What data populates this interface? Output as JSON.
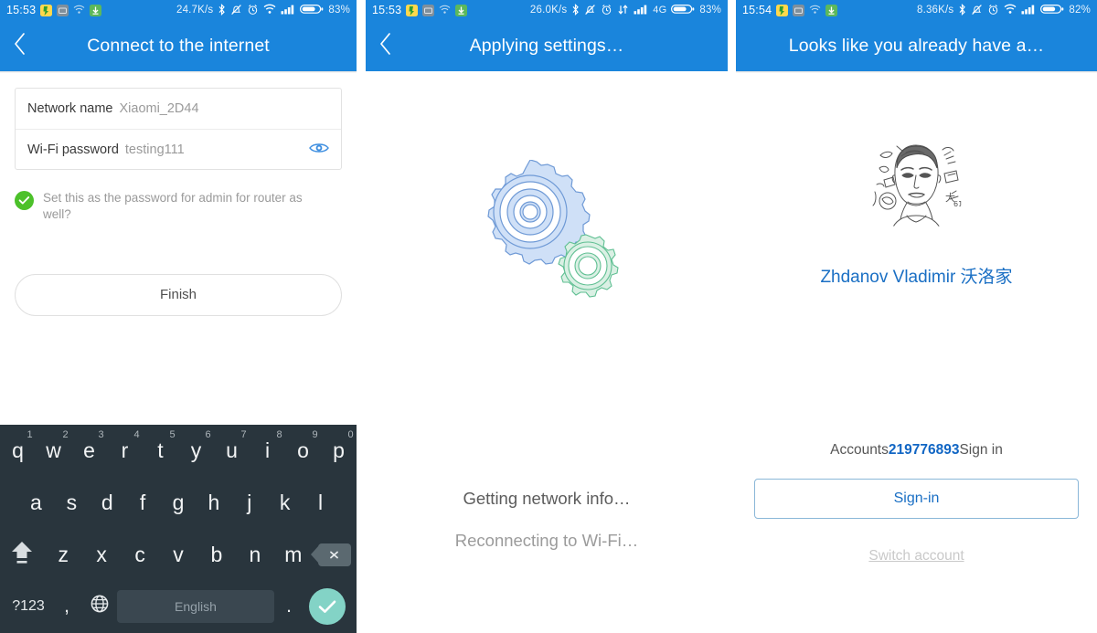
{
  "panels": [
    {
      "statusbar": {
        "time": "15:53",
        "icons_left": [
          "app-yellow-icon",
          "app-gray-icon",
          "wifi-small-icon",
          "download-icon"
        ],
        "net_speed": "24.7K/s",
        "icons_right": [
          "bluetooth-icon",
          "mute-bell-icon",
          "alarm-icon",
          "wifi-icon",
          "signal-bars-icon"
        ],
        "network_type": "",
        "battery": "83%"
      },
      "header": {
        "title": "Connect to the internet",
        "back_icon": "chevron-left-icon"
      },
      "form": {
        "network": {
          "label": "Network name",
          "value": "Xiaomi_2D44"
        },
        "password": {
          "label": "Wi-Fi password",
          "value": "testing111",
          "eye_icon": "eye-icon"
        },
        "checkbox": {
          "checked": true,
          "label": "Set this as the password for admin for router as well?"
        },
        "finish_label": "Finish"
      },
      "keyboard": {
        "row1": [
          {
            "key": "q",
            "num": "1"
          },
          {
            "key": "w",
            "num": "2"
          },
          {
            "key": "e",
            "num": "3"
          },
          {
            "key": "r",
            "num": "4"
          },
          {
            "key": "t",
            "num": "5"
          },
          {
            "key": "y",
            "num": "6"
          },
          {
            "key": "u",
            "num": "7"
          },
          {
            "key": "i",
            "num": "8"
          },
          {
            "key": "o",
            "num": "9"
          },
          {
            "key": "p",
            "num": "0"
          }
        ],
        "row2": [
          "a",
          "s",
          "d",
          "f",
          "g",
          "h",
          "j",
          "k",
          "l"
        ],
        "row3": [
          "z",
          "x",
          "c",
          "v",
          "b",
          "n",
          "m"
        ],
        "shift_icon": "shift-icon",
        "delete_icon": "backspace-icon",
        "symbols_label": "?123",
        "comma_label": ",",
        "globe_icon": "globe-icon",
        "space_label": "English",
        "period_label": ".",
        "enter_icon": "check-icon"
      }
    },
    {
      "statusbar": {
        "time": "15:53",
        "net_speed": "26.0K/s",
        "network_type": "4G",
        "battery": "83%"
      },
      "header": {
        "title": "Applying settings…",
        "back_icon": "chevron-left-icon"
      },
      "graphic": {
        "name": "gears-icon",
        "big_gear_color": "#cfe0f7",
        "small_gear_color": "#daf0e4"
      },
      "status": {
        "line1": "Getting network info…",
        "line2": "Reconnecting to Wi-Fi…"
      }
    },
    {
      "statusbar": {
        "time": "15:54",
        "net_speed": "8.36K/s",
        "network_type": "",
        "battery": "82%"
      },
      "header": {
        "title": "Looks like you already have a…"
      },
      "account": {
        "avatar_icon": "user-avatar-sketch",
        "display_name": "Zhdanov Vladimir 沃洛家",
        "accounts_prefix": "Accounts",
        "accounts_number": "219776893",
        "accounts_suffix": "Sign in",
        "signin_label": "Sign-in",
        "switch_label": "Switch account"
      }
    }
  ],
  "colors": {
    "header_blue": "#1a85dc",
    "keyboard_bg": "#29353d",
    "enter_teal": "#83d3c6",
    "check_green": "#4cc12a",
    "link_blue": "#1a6fc4"
  }
}
